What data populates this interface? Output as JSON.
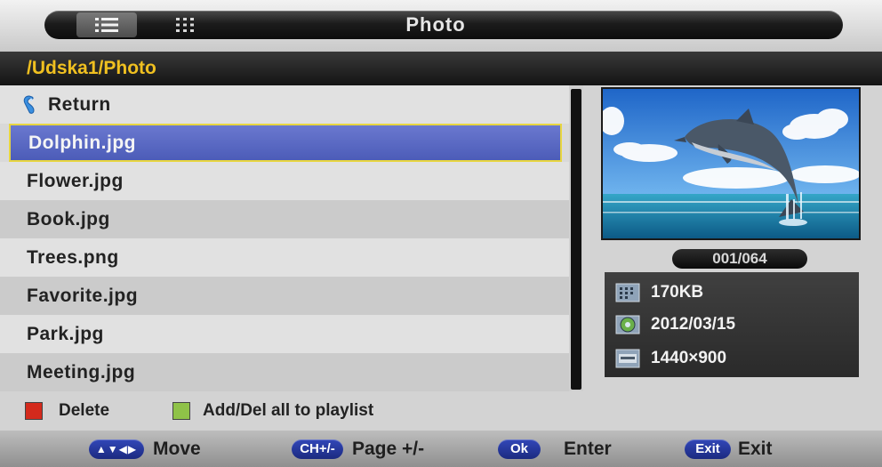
{
  "header": {
    "title": "Photo",
    "view_buttons": [
      {
        "name": "list-view-button",
        "icon": "list-icon",
        "active": true
      },
      {
        "name": "grid-view-button",
        "icon": "grid-icon",
        "active": false
      }
    ]
  },
  "path": "/Udska1/Photo",
  "files": [
    {
      "label": "Return",
      "icon": "return-icon",
      "selected": false
    },
    {
      "label": "Dolphin.jpg",
      "selected": true
    },
    {
      "label": "Flower.jpg",
      "selected": false
    },
    {
      "label": "Book.jpg",
      "selected": false
    },
    {
      "label": "Trees.png",
      "selected": false
    },
    {
      "label": "Favorite.jpg",
      "selected": false
    },
    {
      "label": "Park.jpg",
      "selected": false
    },
    {
      "label": "Meeting.jpg",
      "selected": false
    }
  ],
  "preview": {
    "counter": "001/064",
    "info": {
      "size": "170KB",
      "date": "2012/03/15",
      "resolution": "1440×900"
    },
    "icons": [
      "file-size-icon",
      "calendar-icon",
      "resolution-icon"
    ]
  },
  "actions": [
    {
      "label": "Delete",
      "color": "#d42a1c"
    },
    {
      "label": "Add/Del all to playlist",
      "color": "#8fc248"
    }
  ],
  "hints": [
    {
      "key": "▲▼◀▶",
      "label": "Move"
    },
    {
      "key": "CH+/-",
      "label": "Page +/-"
    },
    {
      "key": "Ok",
      "label": "Enter"
    },
    {
      "key": "Exit",
      "label": "Exit"
    }
  ],
  "colors": {
    "path_text": "#f0c020",
    "selected_row": "#5565c0",
    "selected_border": "#e8d640",
    "key_pill": "#2a3a9c"
  }
}
